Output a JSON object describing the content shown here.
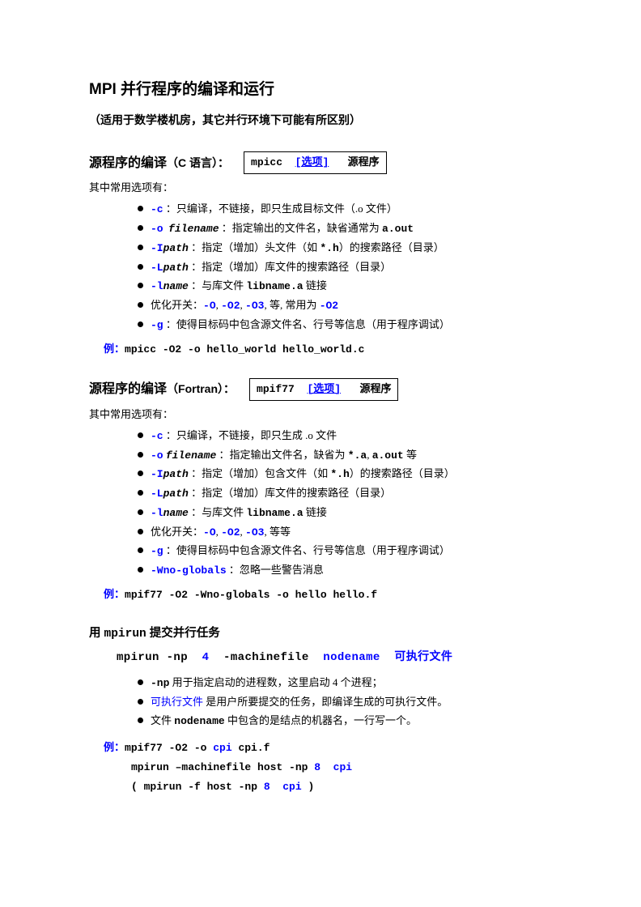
{
  "title": "MPI 并行程序的编译和运行",
  "subtitle": "（适用于数学楼机房，其它并行环境下可能有所区别）",
  "sec1": {
    "head_main": "源程序的编译",
    "head_paren": "（C 语言）：",
    "box_cmd": "mpicc",
    "box_opt": "[选项]",
    "box_arg": "源程序",
    "intro": "其中常用选项有：",
    "items": {
      "c_flag": "-c",
      "c_text": " ：只编译，不链接，即只生成目标文件（.o 文件）",
      "o_flag": "-o",
      "o_arg": "filename",
      "o_text": " ：指定输出的文件名，缺省通常为 ",
      "o_aout": "a.out",
      "I_flag": "-I",
      "I_arg": "path",
      "I_text": " ：指定（增加）头文件（如 ",
      "I_ext": "*.h",
      "I_text2": "）的搜索路径（目录）",
      "L_flag": "-L",
      "L_arg": "path",
      "L_text": " ：指定（增加）库文件的搜索路径（目录）",
      "l_flag": "-l",
      "l_arg": "name",
      "l_text": " ：与库文件 ",
      "l_lib": "libname.a",
      "l_text2": " 链接",
      "opt_pre": "优化开关：",
      "O": "-O",
      "c1": ", ",
      "O2": "-O2",
      "c2": ", ",
      "O3": "-O3",
      "opt_mid": ", 等, 常用为 ",
      "O2b": "-O2",
      "g_flag": "-g",
      "g_text": " ：使得目标码中包含源文件名、行号等信息（用于程序调试）"
    },
    "ex_label": "例：",
    "ex_cmd": "mpicc -O2  -o hello_world  hello_world.c"
  },
  "sec2": {
    "head_main": "源程序的编译",
    "head_paren": "（Fortran）：",
    "box_cmd": "mpif77",
    "box_opt": "[选项]",
    "box_arg": "源程序",
    "intro": "其中常用选项有：",
    "items": {
      "c_flag": "-c",
      "c_text": " ：只编译，不链接，即只生成 .o 文件",
      "o_flag": "-o",
      "o_arg": "filename",
      "o_text": " ：指定输出文件名，缺省为 ",
      "o_a": "*.a",
      "o_comma": ", ",
      "o_aout": "a.out",
      "o_text2": " 等",
      "I_flag": "-I",
      "I_arg": "path",
      "I_text": " ：指定（增加）包含文件（如 ",
      "I_ext": "*.h",
      "I_text2": "）的搜索路径（目录）",
      "L_flag": "-L",
      "L_arg": "path",
      "L_text": " ：指定（增加）库文件的搜索路径（目录）",
      "l_flag": "-l",
      "l_arg": "name",
      "l_text": " ：与库文件 ",
      "l_lib": "libname.a",
      "l_text2": " 链接",
      "opt_pre": "优化开关：",
      "O": "-O",
      "c1": ", ",
      "O2": "-O2",
      "c2": ", ",
      "O3": "-O3",
      "opt_mid": ", 等等",
      "g_flag": "-g",
      "g_text": " ：使得目标码中包含源文件名、行号等信息（用于程序调试）",
      "W_flag": "-Wno-globals",
      "W_text": " ：忽略一些警告消息"
    },
    "ex_label": "例：",
    "ex_cmd": "mpif77 -O2 -Wno-globals -o hello hello.f"
  },
  "sec3": {
    "head_pre": "用 ",
    "head_cmd": "mpirun",
    "head_post": " 提交并行任务",
    "line_a": "mpirun  -np",
    "line_n": "4",
    "line_b": "-machinefile",
    "line_c": "nodename",
    "line_d": "可执行文件",
    "items": {
      "np_flag": "-np",
      "np_text": " 用于指定启动的进程数，这里启动 4 个进程；",
      "exe": "可执行文件",
      "exe_text": " 是用户所要提交的任务，即编译生成的可执行文件。",
      "node_pre": "文件 ",
      "node": "nodename",
      "node_post": " 中包含的是结点的机器名，一行写一个。"
    },
    "ex_label": "例：",
    "ex1a": "mpif77 -O2 -o ",
    "ex1b": "cpi",
    "ex1c": "  cpi.f",
    "ex2a": "mpirun –machinefile host -np ",
    "ex2n": "8",
    "ex2b": "cpi",
    "ex3a": "( mpirun -f host -np ",
    "ex3n": "8",
    "ex3b": "cpi",
    "ex3c": " )"
  }
}
